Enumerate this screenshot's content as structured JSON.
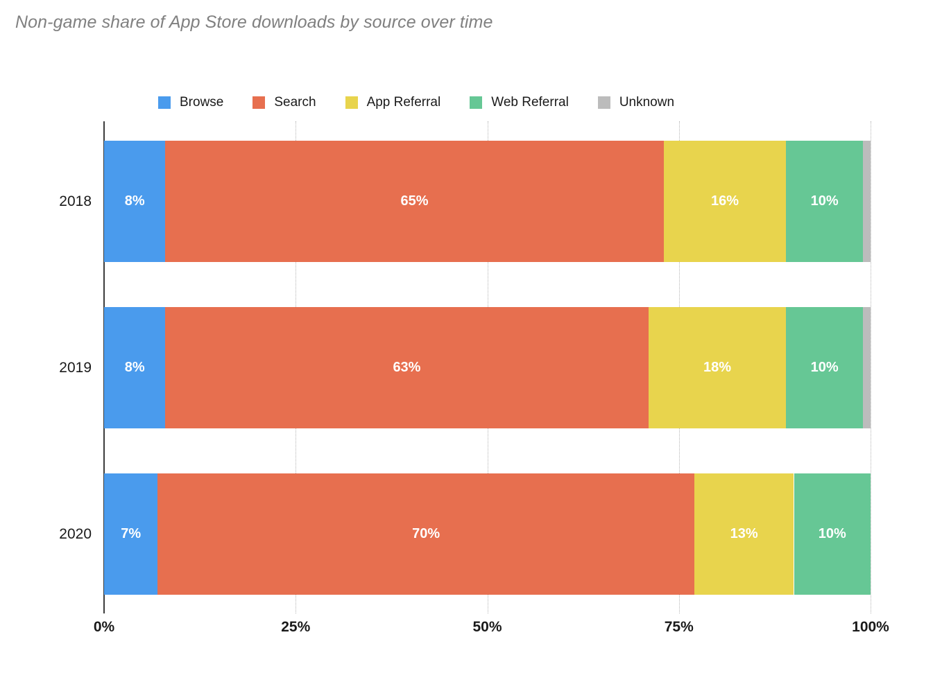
{
  "chart_data": {
    "type": "bar",
    "orientation": "horizontal",
    "stacked": true,
    "normalized": true,
    "title": "Non-game share of App Store downloads by source over time",
    "xlabel": "",
    "ylabel": "",
    "categories": [
      "2018",
      "2019",
      "2020"
    ],
    "xlim": [
      0,
      100
    ],
    "xticks": [
      "0%",
      "25%",
      "50%",
      "75%",
      "100%"
    ],
    "xtick_values": [
      0,
      25,
      50,
      75,
      100
    ],
    "grid": "vertical-dotted",
    "legend_position": "top",
    "series": [
      {
        "name": "Browse",
        "color": "#4a9bed",
        "values": [
          8,
          8,
          7
        ],
        "labels": [
          "8%",
          "8%",
          "7%"
        ]
      },
      {
        "name": "Search",
        "color": "#e76f4f",
        "values": [
          65,
          63,
          70
        ],
        "labels": [
          "65%",
          "63%",
          "70%"
        ]
      },
      {
        "name": "App Referral",
        "color": "#e8d44d",
        "values": [
          16,
          18,
          13
        ],
        "labels": [
          "16%",
          "18%",
          "13%"
        ]
      },
      {
        "name": "Web Referral",
        "color": "#66c795",
        "values": [
          10,
          10,
          10
        ],
        "labels": [
          "10%",
          "10%",
          "10%"
        ]
      },
      {
        "name": "Unknown",
        "color": "#bcbcbc",
        "values": [
          1,
          1,
          0
        ],
        "labels": [
          "",
          "",
          ""
        ]
      }
    ]
  },
  "legend": {
    "items": [
      {
        "label": "Browse",
        "color": "#4a9bed"
      },
      {
        "label": "Search",
        "color": "#e76f4f"
      },
      {
        "label": "App Referral",
        "color": "#e8d44d"
      },
      {
        "label": "Web Referral",
        "color": "#66c795"
      },
      {
        "label": "Unknown",
        "color": "#bcbcbc"
      }
    ]
  },
  "axis": {
    "x_ticks": [
      "0%",
      "25%",
      "50%",
      "75%",
      "100%"
    ],
    "y_labels": [
      "2018",
      "2019",
      "2020"
    ]
  },
  "colors": {
    "title": "#808080",
    "axis_line": "#3c3c3c",
    "gridline": "#b4b4b4",
    "label_text": "#1a1a1a",
    "bar_label_text": "#ffffff",
    "background": "#ffffff"
  }
}
